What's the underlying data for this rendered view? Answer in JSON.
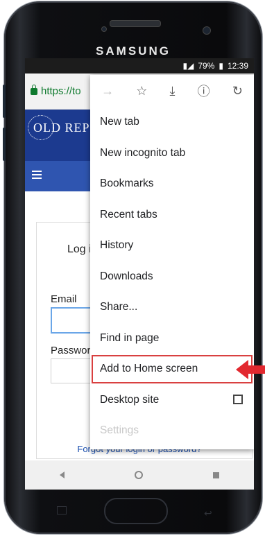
{
  "device": {
    "brand": "SAMSUNG"
  },
  "status_bar": {
    "battery": "79%",
    "time": "12:39"
  },
  "browser": {
    "url_partial": "https://to"
  },
  "site": {
    "logo_text": "OLD REPU"
  },
  "login": {
    "title_partial": "Log in",
    "email_label": "Email",
    "password_label": "Passwor",
    "forgot_link": "Forgot your login or password?"
  },
  "menu": {
    "top_icons": [
      "forward-icon",
      "star-icon",
      "download-icon",
      "info-icon",
      "refresh-icon"
    ],
    "items": [
      {
        "label": "New tab"
      },
      {
        "label": "New incognito tab"
      },
      {
        "label": "Bookmarks"
      },
      {
        "label": "Recent tabs"
      },
      {
        "label": "History"
      },
      {
        "label": "Downloads"
      },
      {
        "label": "Share..."
      },
      {
        "label": "Find in page"
      },
      {
        "label": "Add to Home screen"
      },
      {
        "label": "Desktop site"
      },
      {
        "label": "Settings"
      }
    ],
    "highlight_color": "#d94040"
  }
}
